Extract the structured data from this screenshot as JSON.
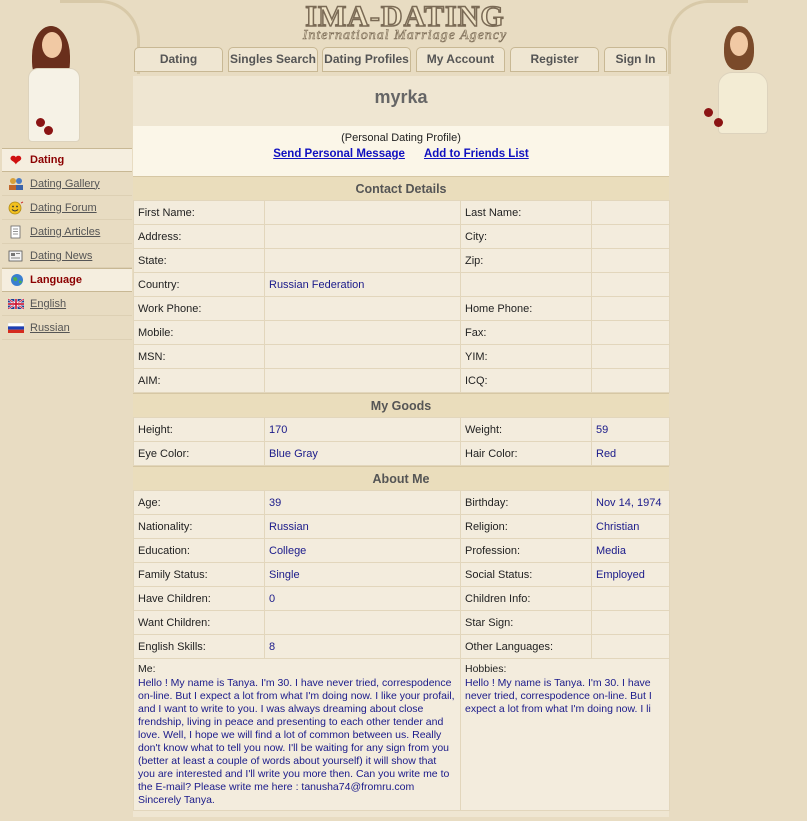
{
  "logo": {
    "title": "IMA-DATING",
    "subtitle": "International Marriage Agency"
  },
  "nav": [
    {
      "label": "Dating"
    },
    {
      "label": "Singles Search"
    },
    {
      "label": "Dating Profiles"
    },
    {
      "label": "My Account"
    },
    {
      "label": "Register"
    },
    {
      "label": "Sign In"
    }
  ],
  "sidebar": {
    "dating_head": "Dating",
    "dating_items": [
      {
        "label": "Dating Gallery",
        "icon": "gallery-icon"
      },
      {
        "label": "Dating Forum",
        "icon": "smiley-icon"
      },
      {
        "label": "Dating Articles",
        "icon": "article-icon"
      },
      {
        "label": "Dating News",
        "icon": "news-icon"
      }
    ],
    "language_head": "Language",
    "language_items": [
      {
        "label": "English",
        "icon": "uk-flag-icon"
      },
      {
        "label": "Russian",
        "icon": "russia-flag-icon"
      }
    ]
  },
  "profile": {
    "name": "myrka",
    "type_label": "(Personal Dating Profile)",
    "send_message": "Send Personal Message",
    "add_friends": "Add to Friends List"
  },
  "contact": {
    "heading": "Contact Details",
    "rows": [
      [
        "First Name:",
        "",
        "Last Name:",
        ""
      ],
      [
        "Address:",
        "",
        "City:",
        ""
      ],
      [
        "State:",
        "",
        "Zip:",
        ""
      ],
      [
        "Country:",
        "Russian Federation",
        "",
        ""
      ],
      [
        "Work Phone:",
        "",
        "Home Phone:",
        ""
      ],
      [
        "Mobile:",
        "",
        "Fax:",
        ""
      ],
      [
        "MSN:",
        "",
        "YIM:",
        ""
      ],
      [
        "AIM:",
        "",
        "ICQ:",
        ""
      ]
    ]
  },
  "goods": {
    "heading": "My Goods",
    "rows": [
      [
        "Height:",
        "170",
        "Weight:",
        "59"
      ],
      [
        "Eye Color:",
        "Blue Gray",
        "Hair Color:",
        "Red"
      ]
    ]
  },
  "about": {
    "heading": "About Me",
    "rows": [
      [
        "Age:",
        "39",
        "Birthday:",
        "Nov 14, 1974"
      ],
      [
        "Nationality:",
        "Russian",
        "Religion:",
        "Christian"
      ],
      [
        "Education:",
        "College",
        "Profession:",
        "Media"
      ],
      [
        "Family Status:",
        "Single",
        "Social Status:",
        "Employed"
      ],
      [
        "Have Children:",
        "0",
        "Children Info:",
        ""
      ],
      [
        "Want Children:",
        "",
        "Star Sign:",
        ""
      ],
      [
        "English Skills:",
        "8",
        "Other Languages:",
        ""
      ]
    ],
    "me_label": "Me:",
    "me_text": "Hello ! My name is Tanya. I'm 30. I have never tried, correspodence on-line. But I expect a lot from what I'm doing now. I like your profail, and I want to write to you. I was always dreaming about close frendship, living in peace and presenting to each other tender and love. Well, I hope we will find a lot of common between us. Really don't know what to tell you now. I'll be waiting for any sign from you (better at least a couple of words about yourself) it will show that you are interested and I'll write you more then. Can you write me to the E-mail? Please write me here : tanusha74@fromru.com Sincerely Tanya.",
    "hobbies_label": "Hobbies:",
    "hobbies_text": "Hello ! My name is Tanya. I'm 30. I have never tried, correspodence on-line. But I expect a lot from what I'm doing now. I li"
  }
}
